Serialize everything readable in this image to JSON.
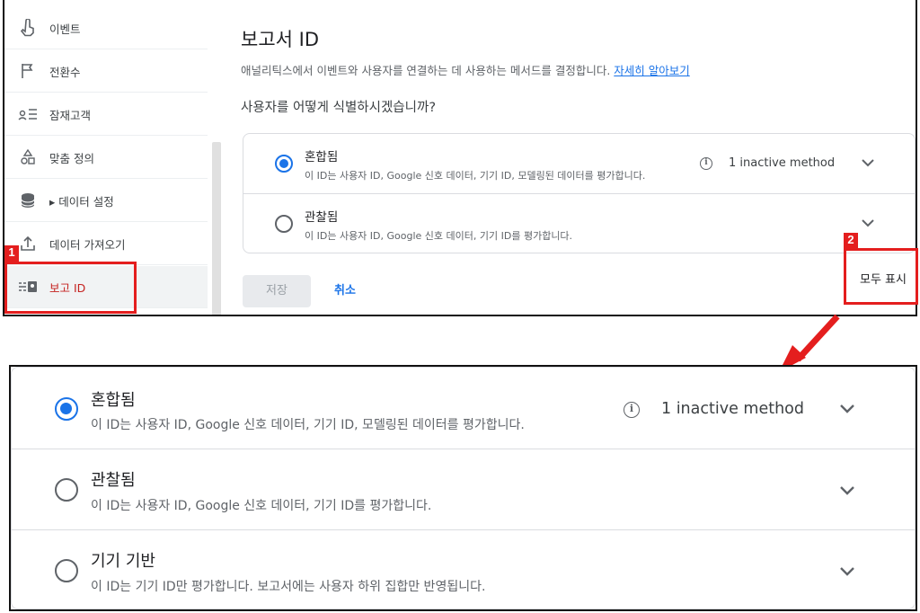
{
  "sidebar": {
    "items": [
      {
        "label": "이벤트",
        "icon": "touch-icon"
      },
      {
        "label": "전환수",
        "icon": "flag-icon"
      },
      {
        "label": "잠재고객",
        "icon": "audience-icon"
      },
      {
        "label": "맞춤 정의",
        "icon": "shapes-icon"
      },
      {
        "label": "▸ 데이터 설정",
        "icon": "database-icon"
      },
      {
        "label": "데이터 가져오기",
        "icon": "upload-icon"
      },
      {
        "label": "보고 ID",
        "icon": "reporting-id-icon",
        "active": true
      }
    ]
  },
  "main": {
    "title": "보고서 ID",
    "description": "애널리틱스에서 이벤트와 사용자를 연결하는 데 사용하는 메서드를 결정합니다.",
    "learn_more": "자세히 알아보기",
    "question": "사용자를 어떻게 식별하시겠습니까?",
    "options": [
      {
        "title": "혼합됨",
        "subtitle": "이 ID는 사용자 ID, Google 신호 데이터, 기기 ID, 모델링된 데이터를 평가합니다.",
        "selected": true,
        "info": "1 inactive method"
      },
      {
        "title": "관찰됨",
        "subtitle": "이 ID는 사용자 ID, Google 신호 데이터, 기기 ID를 평가합니다.",
        "selected": false
      }
    ],
    "save_label": "저장",
    "cancel_label": "취소",
    "show_all_label": "모두 표시"
  },
  "annotations": {
    "tag1": "1",
    "tag2": "2",
    "color": "#e41e1e"
  },
  "zoom": {
    "options": [
      {
        "title": "혼합됨",
        "subtitle": "이 ID는 사용자 ID, Google 신호 데이터, 기기 ID, 모델링된 데이터를 평가합니다.",
        "selected": true,
        "info": "1 inactive method"
      },
      {
        "title": "관찰됨",
        "subtitle": "이 ID는 사용자 ID, Google 신호 데이터, 기기 ID를 평가합니다.",
        "selected": false
      },
      {
        "title": "기기 기반",
        "subtitle": "이 ID는 기기 ID만 평가합니다. 보고서에는 사용자 하위 집합만 반영됩니다.",
        "selected": false
      }
    ]
  },
  "colors": {
    "accent": "#1a73e8",
    "active_text": "#c5221f",
    "annotation": "#e41e1e"
  }
}
